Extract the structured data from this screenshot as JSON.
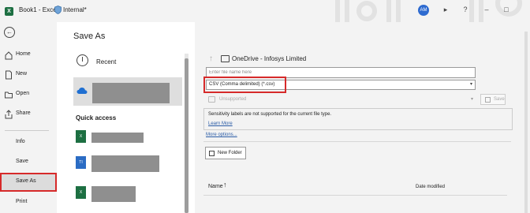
{
  "titlebar": {
    "app_title": "Book1 - Excel",
    "sensitivity": "Internal*",
    "user_initials": "AM",
    "app_letter": "X",
    "colors": {
      "excel_green": "#1d6f42",
      "avatar": "#2e6bd0"
    }
  },
  "nav": {
    "items": [
      {
        "label": "Home"
      },
      {
        "label": "New"
      },
      {
        "label": "Open"
      },
      {
        "label": "Share"
      },
      {
        "label": "Info"
      },
      {
        "label": "Save"
      },
      {
        "label": "Save As"
      },
      {
        "label": "Print"
      }
    ]
  },
  "page": {
    "title": "Save As"
  },
  "locations": {
    "recent_label": "Recent",
    "quick_access_label": "Quick access",
    "quick_access_icons": [
      "X",
      "TI",
      "X"
    ],
    "colors": {
      "redaction": "#8f8f8f",
      "highlight": "#d62a2a"
    }
  },
  "save_panel": {
    "location": "OneDrive - Infosys Limited",
    "filename_placeholder": "Enter file name here",
    "file_type": "CSV (Comma delimited) (*.csv)",
    "sensitivity_value": "Unsupported",
    "save_label": "Save",
    "notice_text": "Sensitivity labels are not supported for the current file type.",
    "learn_more": "Learn More",
    "more_options": "More options...",
    "new_folder": "New Folder",
    "col_name": "Name",
    "sort_glyph": "↑",
    "col_date": "Date modified"
  }
}
